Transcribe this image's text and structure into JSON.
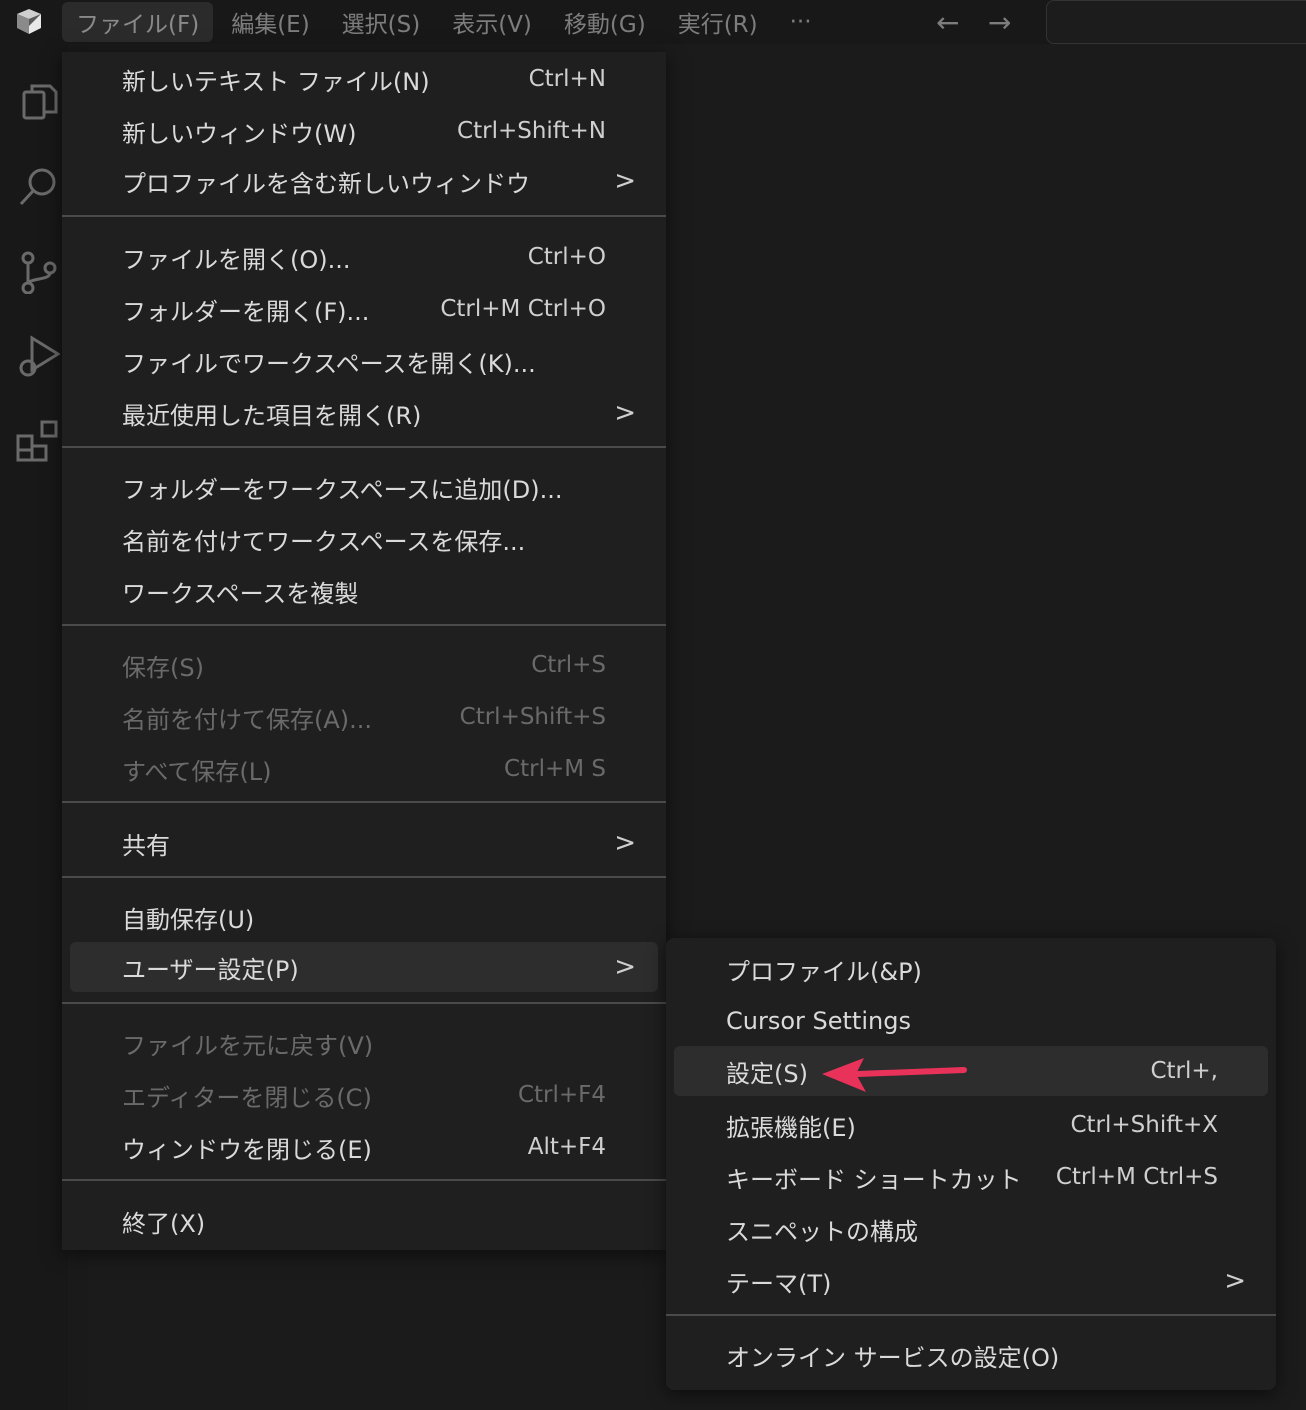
{
  "menubar": {
    "items": [
      "ファイル(F)",
      "編集(E)",
      "選択(S)",
      "表示(V)",
      "移動(G)",
      "実行(R)",
      "···"
    ],
    "back": "←",
    "forward": "→"
  },
  "file_menu": {
    "items": [
      {
        "label": "新しいテキスト ファイル(N)",
        "shortcut": "Ctrl+N"
      },
      {
        "label": "新しいウィンドウ(W)",
        "shortcut": "Ctrl+Shift+N"
      },
      {
        "label": "プロファイルを含む新しいウィンドウ",
        "chevron": ">"
      },
      {
        "label": "ファイルを開く(O)...",
        "shortcut": "Ctrl+O"
      },
      {
        "label": "フォルダーを開く(F)...",
        "shortcut": "Ctrl+M Ctrl+O"
      },
      {
        "label": "ファイルでワークスペースを開く(K)..."
      },
      {
        "label": "最近使用した項目を開く(R)",
        "chevron": ">"
      },
      {
        "label": "フォルダーをワークスペースに追加(D)..."
      },
      {
        "label": "名前を付けてワークスペースを保存..."
      },
      {
        "label": "ワークスペースを複製"
      },
      {
        "label": "保存(S)",
        "shortcut": "Ctrl+S"
      },
      {
        "label": "名前を付けて保存(A)...",
        "shortcut": "Ctrl+Shift+S"
      },
      {
        "label": "すべて保存(L)",
        "shortcut": "Ctrl+M S"
      },
      {
        "label": "共有",
        "chevron": ">"
      },
      {
        "label": "自動保存(U)"
      },
      {
        "label": "ユーザー設定(P)",
        "chevron": ">"
      },
      {
        "label": "ファイルを元に戻す(V)"
      },
      {
        "label": "エディターを閉じる(C)",
        "shortcut": "Ctrl+F4"
      },
      {
        "label": "ウィンドウを閉じる(E)",
        "shortcut": "Alt+F4"
      },
      {
        "label": "終了(X)"
      }
    ]
  },
  "preferences_submenu": {
    "items": [
      {
        "label": "プロファイル(&P)"
      },
      {
        "label": "Cursor Settings"
      },
      {
        "label": "設定(S)",
        "shortcut": "Ctrl+,"
      },
      {
        "label": "拡張機能(E)",
        "shortcut": "Ctrl+Shift+X"
      },
      {
        "label": "キーボード ショートカット",
        "shortcut": "Ctrl+M Ctrl+S"
      },
      {
        "label": "スニペットの構成"
      },
      {
        "label": "テーマ(T)",
        "chevron": ">"
      },
      {
        "label": "オンライン サービスの設定(O)"
      }
    ]
  },
  "activity_icons": [
    "explorer-icon",
    "search-icon",
    "source-control-icon",
    "run-debug-icon",
    "extensions-icon"
  ],
  "colors": {
    "accent_arrow": "#e8325a",
    "menu_bg": "#1f1f1f",
    "highlight": "#2d2d2d"
  }
}
